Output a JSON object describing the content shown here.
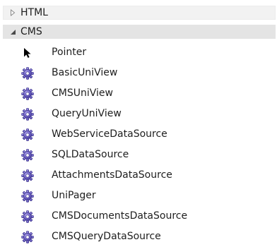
{
  "groups": [
    {
      "label": "HTML",
      "expanded": false
    },
    {
      "label": "CMS",
      "expanded": true
    }
  ],
  "items": [
    {
      "label": "Pointer",
      "icon": "pointer-icon"
    },
    {
      "label": "BasicUniView",
      "icon": "gear-icon"
    },
    {
      "label": "CMSUniView",
      "icon": "gear-icon"
    },
    {
      "label": "QueryUniView",
      "icon": "gear-icon"
    },
    {
      "label": "WebServiceDataSource",
      "icon": "gear-icon"
    },
    {
      "label": "SQLDataSource",
      "icon": "gear-icon"
    },
    {
      "label": "AttachmentsDataSource",
      "icon": "gear-icon"
    },
    {
      "label": "UniPager",
      "icon": "gear-icon"
    },
    {
      "label": "CMSDocumentsDataSource",
      "icon": "gear-icon"
    },
    {
      "label": "CMSQueryDataSource",
      "icon": "gear-icon"
    }
  ],
  "colors": {
    "gear_fill": "#6f63c4",
    "gear_dark": "#3f3596",
    "header_expanded": "#e4e4e4",
    "header_collapsed": "#f2f2f2"
  }
}
